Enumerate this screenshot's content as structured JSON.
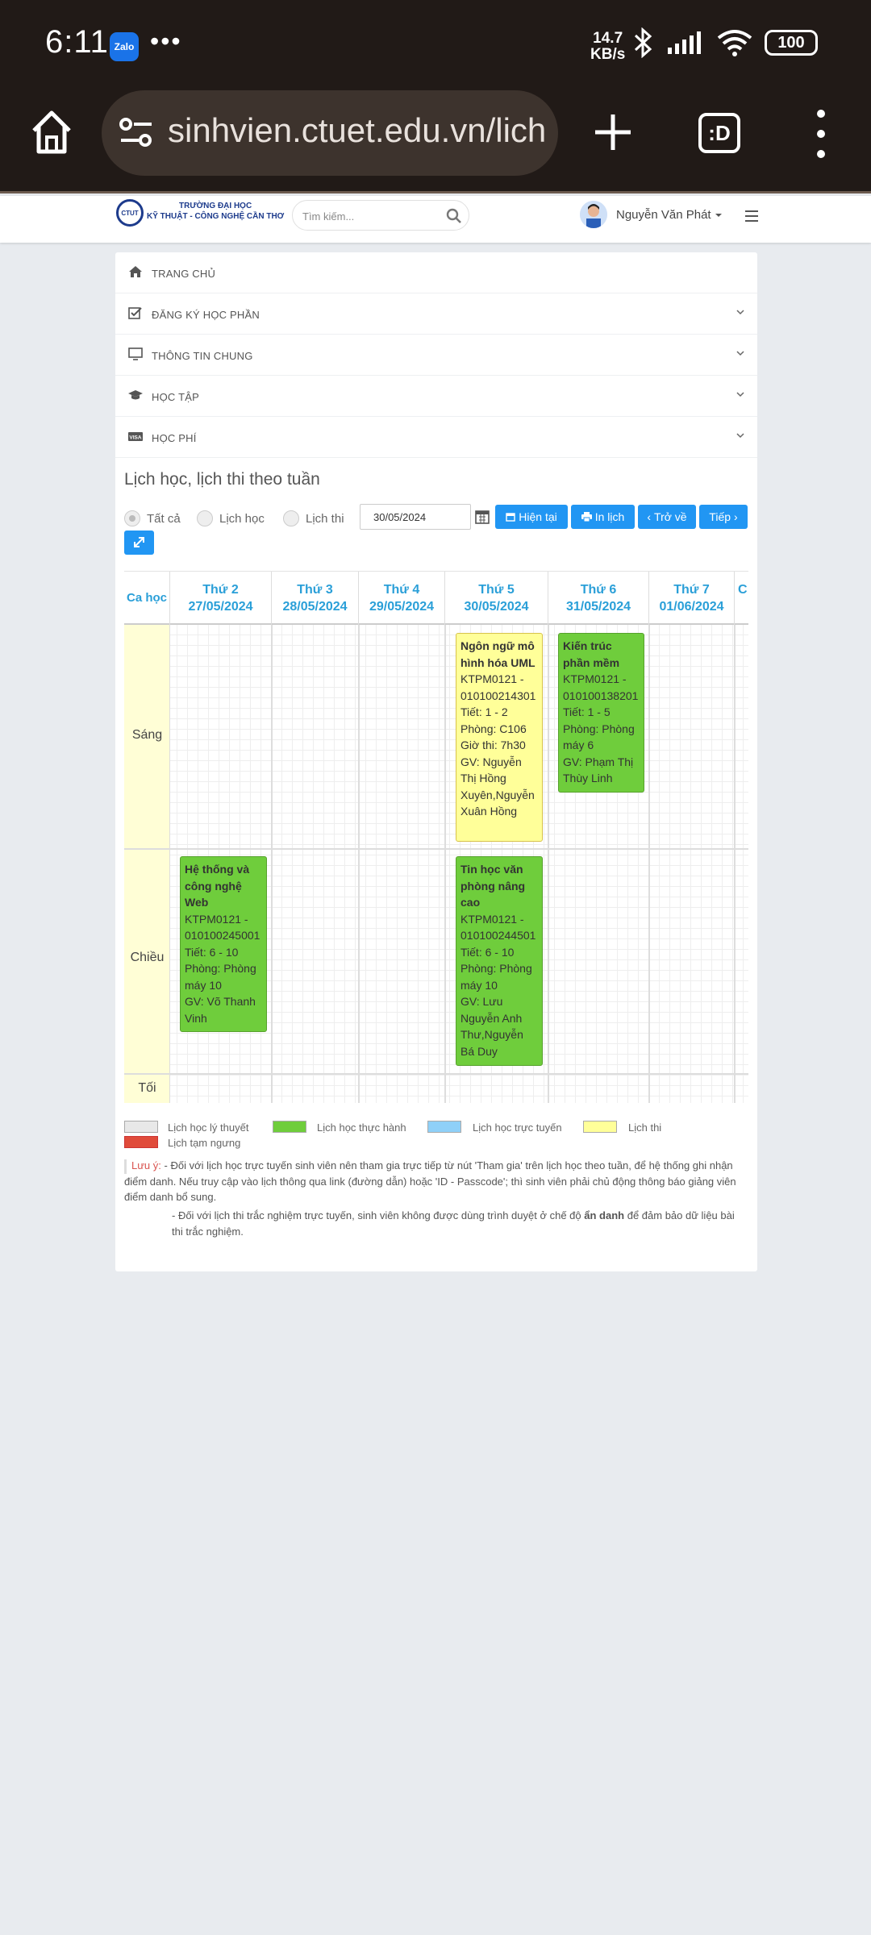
{
  "statusbar": {
    "time": "6:11",
    "app_icon": "Zalo",
    "more": "•••",
    "net_speed_value": "14.7",
    "net_speed_unit": "KB/s",
    "battery": "100"
  },
  "browser": {
    "url": "sinhvien.ctuet.edu.vn/lich",
    "tabs_label": ":D"
  },
  "site": {
    "logo_mark": "CTUT",
    "logo_line1": "TRƯỜNG ĐẠI HỌC",
    "logo_line2": "KỸ THUẬT - CÔNG NGHỆ CẦN THƠ",
    "search_placeholder": "Tìm kiếm...",
    "user_name": "Nguyễn Văn Phát"
  },
  "nav": [
    {
      "label": "TRANG CHỦ",
      "icon": "home-icon"
    },
    {
      "label": "ĐĂNG KÝ HỌC PHẦN",
      "icon": "checkbox-icon"
    },
    {
      "label": "THÔNG TIN CHUNG",
      "icon": "monitor-icon"
    },
    {
      "label": "HỌC TẬP",
      "icon": "graduation-cap-icon"
    },
    {
      "label": "HỌC PHÍ",
      "icon": "visa-card-icon"
    }
  ],
  "schedule": {
    "title": "Lịch học, lịch thi theo tuần",
    "filter_all": "Tất cả",
    "filter_study": "Lịch học",
    "filter_exam": "Lịch thi",
    "date": "30/05/2024",
    "btn_today": "Hiện tại",
    "btn_print": "In lịch",
    "btn_back": "Trở về",
    "btn_next": "Tiếp",
    "col_ca": "Ca học",
    "days": [
      {
        "name": "Thứ 2",
        "date": "27/05/2024"
      },
      {
        "name": "Thứ 3",
        "date": "28/05/2024"
      },
      {
        "name": "Thứ 4",
        "date": "29/05/2024"
      },
      {
        "name": "Thứ 5",
        "date": "30/05/2024"
      },
      {
        "name": "Thứ 6",
        "date": "31/05/2024"
      },
      {
        "name": "Thứ 7",
        "date": "01/06/2024"
      },
      {
        "name": "C",
        "date": ""
      }
    ],
    "slots": {
      "morning": "Sáng",
      "afternoon": "Chiều",
      "evening": "Tối"
    },
    "events": [
      {
        "id": "uml",
        "type": "exam",
        "title": "Ngôn ngữ mô hình hóa UML",
        "lines": [
          "KTPM0121 -",
          "010100214301",
          "Tiết: 1 - 2",
          "Phòng: C106",
          "Giờ thi: 7h30",
          "GV: Nguyễn",
          "Thị Hồng",
          "Xuyên,Nguyễn",
          "Xuân Hồng"
        ]
      },
      {
        "id": "kientruc",
        "type": "practice",
        "title": "Kiến trúc phần mềm",
        "lines": [
          "KTPM0121 -",
          "010100138201",
          "Tiết: 1 - 5",
          "Phòng: Phòng",
          "máy 6",
          "GV: Phạm Thị",
          "Thùy Linh"
        ]
      },
      {
        "id": "web",
        "type": "practice",
        "title": "Hệ thống và công nghệ Web",
        "lines": [
          "KTPM0121 -",
          "010100245001",
          "Tiết: 6 - 10",
          "Phòng: Phòng",
          "máy 10",
          "GV: Võ Thanh",
          "Vinh"
        ]
      },
      {
        "id": "tinhoc",
        "type": "practice",
        "title": "Tin học văn phòng nâng cao",
        "lines": [
          "KTPM0121 -",
          "010100244501",
          "Tiết: 6 - 10",
          "Phòng: Phòng",
          "máy 10",
          "GV: Lưu",
          "Nguyễn Anh",
          "Thư,Nguyễn",
          "Bá Duy"
        ]
      }
    ]
  },
  "legend": {
    "theory": "Lịch học lý thuyết",
    "practice": "Lịch học thực hành",
    "online": "Lịch học trực tuyến",
    "exam": "Lịch thi",
    "paused": "Lịch tạm ngưng",
    "colors": {
      "theory": "#e8e8e8",
      "practice": "#6fcd3c",
      "online": "#8fd0f8",
      "exam": "#ffff99",
      "paused": "#e04b3a"
    }
  },
  "notes": {
    "label": "Lưu ý:",
    "note1": "- Đối với lịch học trực tuyến sinh viên nên tham gia trực tiếp từ nút 'Tham gia' trên lịch học theo tuần, để hệ thống ghi nhận điểm danh. Nếu truy cập vào lịch thông qua link (đường dẫn) hoặc 'ID - Passcode'; thì sinh viên phải chủ động thông báo giảng viên điểm danh bổ sung.",
    "note2_a": "- Đối với lịch thi trắc nghiệm trực tuyến, sinh viên không được dùng trình duyệt ở chế độ",
    "note2_bold": "ẩn danh",
    "note2_b": "để đảm bảo dữ liệu bài thi trắc nghiệm."
  }
}
